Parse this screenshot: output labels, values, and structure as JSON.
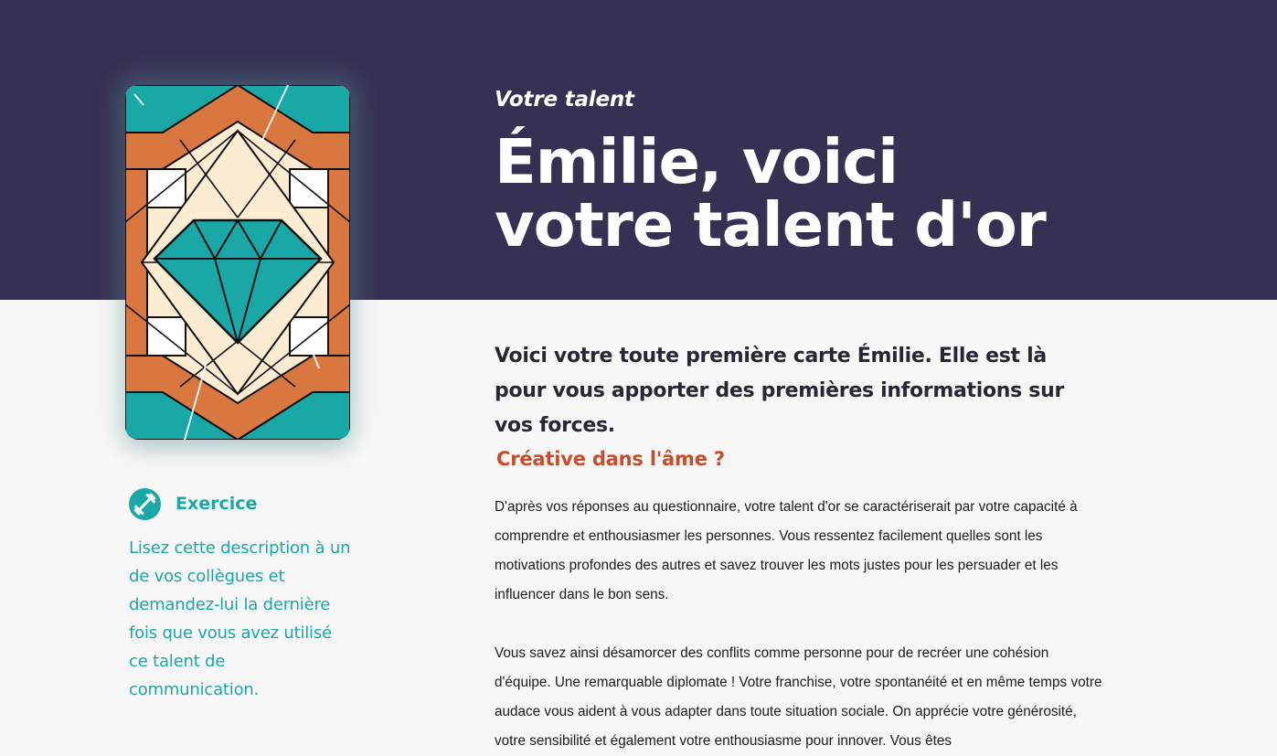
{
  "hero": {
    "eyebrow": "Votre talent",
    "title": "Émilie, voici votre talent d'or"
  },
  "card": {
    "icon": "diamond-icon",
    "colors": {
      "teal": "#1aa8a6",
      "orange": "#d97741",
      "cream": "#fbecd2",
      "outline": "#111111"
    }
  },
  "exercise": {
    "icon": "dumbbell-icon",
    "label": "Exercice",
    "text": "Lisez cette description à un de vos collègues et demandez-lui la dernière fois que vous avez utilisé ce talent de communication."
  },
  "content": {
    "lead": "Voici votre toute première carte Émilie. Elle est là pour vous apporter des premières informations sur vos forces.",
    "subheading": "Créative dans l'âme ?",
    "paragraph1": "D'après vos réponses au questionnaire, votre talent d'or se caractériserait par votre capacité à comprendre et enthousiasmer les personnes. Vous ressentez facilement quelles sont les motivations profondes des autres et savez trouver les mots justes pour les persuader et les influencer dans le bon sens.",
    "paragraph2": "Vous savez ainsi désamorcer des conflits comme personne pour de recréer une cohésion d'équipe. Une remarquable diplomate ! Votre franchise, votre spontanéité et en même temps votre audace vous aident à vous adapter dans toute situation sociale. On apprécie votre générosité, votre sensibilité et également votre enthousiasme pour innover. Vous êtes"
  },
  "colors": {
    "hero_bg": "#363152",
    "page_bg": "#f7f7f7",
    "accent_teal": "#1aa8a6",
    "accent_orange": "#c84e2b"
  }
}
